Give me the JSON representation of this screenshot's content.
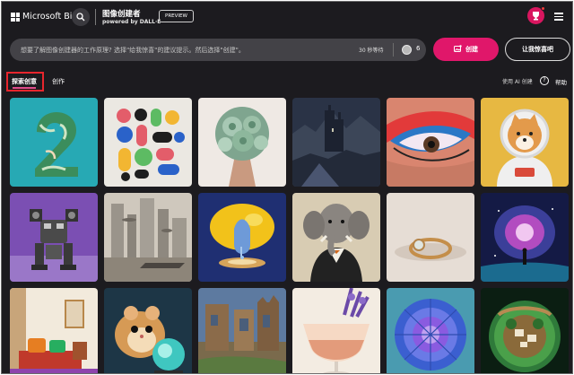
{
  "header": {
    "brand": "Microsoft Bing",
    "app_title": "图像创建者",
    "app_subtitle": "powered by DALL·E",
    "preview_badge": "PREVIEW"
  },
  "prompt": {
    "placeholder": "想要了解图像创建器的工作原理? 选择\"给我惊喜\"的建议提示。然后选择\"创建\"。",
    "wait_label": "30 秒等待",
    "boost_count": "6"
  },
  "actions": {
    "create_label": "创建",
    "surprise_label": "让我惊喜吧"
  },
  "tabs": [
    {
      "label": "探索创意",
      "active": true
    },
    {
      "label": "创作",
      "active": false
    }
  ],
  "right_links": {
    "ai_label": "使用 AI 创建",
    "help_label": "帮助"
  },
  "gallery": [
    {
      "icon": "leafy-number-two-image"
    },
    {
      "icon": "abstract-colorful-shapes-image"
    },
    {
      "icon": "succulent-bouquet-image"
    },
    {
      "icon": "dark-gothic-castle-image"
    },
    {
      "icon": "colorful-eye-makeup-image"
    },
    {
      "icon": "shiba-astronaut-image"
    },
    {
      "icon": "purple-robot-image"
    },
    {
      "icon": "sepia-ruined-city-image"
    },
    {
      "icon": "lemon-faucet-surreal-image"
    },
    {
      "icon": "elephant-in-tuxedo-image"
    },
    {
      "icon": "gold-ring-image"
    },
    {
      "icon": "galaxy-portal-person-image"
    },
    {
      "icon": "colorful-bedroom-image"
    },
    {
      "icon": "hamster-crystal-ball-image"
    },
    {
      "icon": "stone-ruins-painting-image"
    },
    {
      "icon": "floral-cocktail-image"
    },
    {
      "icon": "blue-dahlia-flower-image"
    },
    {
      "icon": "terrarium-village-image"
    }
  ],
  "colors": {
    "accent": "#e0176a",
    "background": "#1c1b1f",
    "highlight_box": "#e8262d"
  }
}
